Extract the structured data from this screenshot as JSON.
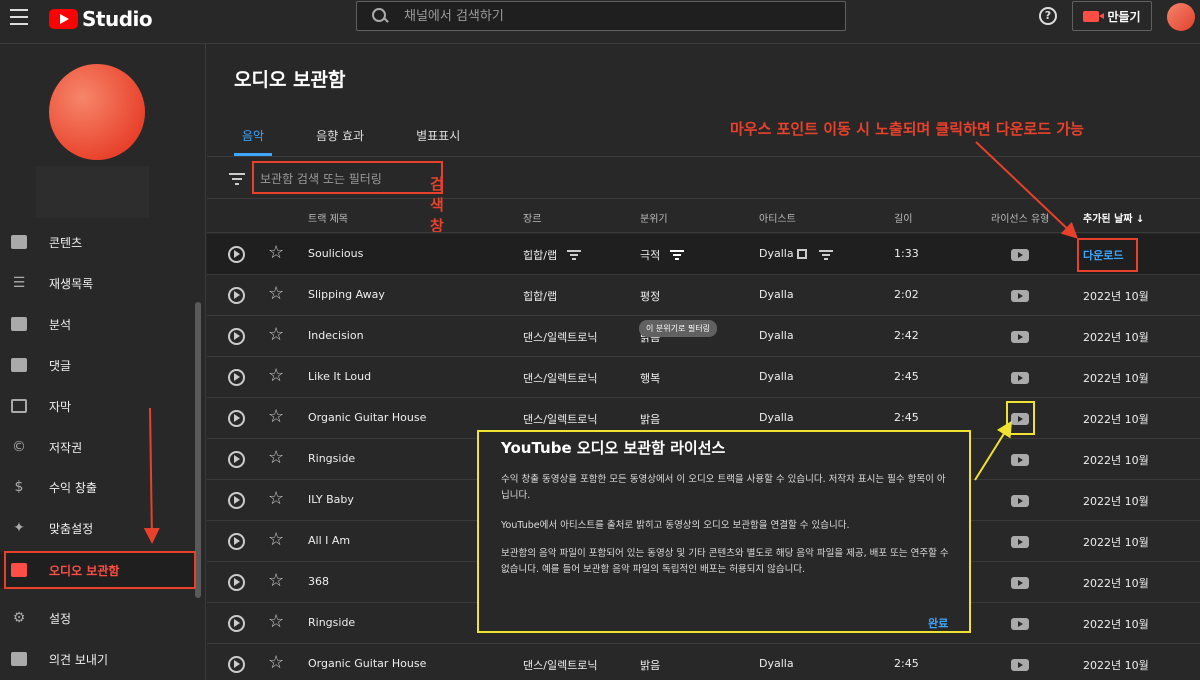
{
  "header": {
    "logo_text": "Studio",
    "search_placeholder": "채널에서 검색하기",
    "create_label": "만들기"
  },
  "sidebar": {
    "items": [
      {
        "label": "콘텐츠",
        "icon": "content-icon"
      },
      {
        "label": "재생목록",
        "icon": "playlist-icon"
      },
      {
        "label": "분석",
        "icon": "analytics-icon"
      },
      {
        "label": "댓글",
        "icon": "comments-icon"
      },
      {
        "label": "자막",
        "icon": "subtitles-icon"
      },
      {
        "label": "저작권",
        "icon": "copyright-icon"
      },
      {
        "label": "수익 창출",
        "icon": "dollar-icon"
      },
      {
        "label": "맞춤설정",
        "icon": "magic-wand-icon"
      },
      {
        "label": "오디오 보관함",
        "icon": "audio-library-icon",
        "active": true
      },
      {
        "label": "설정",
        "icon": "gear-icon"
      },
      {
        "label": "의견 보내기",
        "icon": "feedback-icon"
      }
    ]
  },
  "main": {
    "title": "오디오 보관함",
    "tabs": [
      {
        "label": "음악",
        "active": true
      },
      {
        "label": "음향 효과"
      },
      {
        "label": "별표표시"
      }
    ],
    "filter_placeholder": "보관함 검색 또는 필터링",
    "columns": {
      "title": "트랙 제목",
      "genre": "장르",
      "mood": "분위기",
      "artist": "아티스트",
      "duration": "길이",
      "license": "라이선스 유형",
      "date": "추가된 날짜"
    },
    "rows": [
      {
        "title": "Soulicious",
        "genre": "힙합/랩",
        "mood": "극적",
        "artist": "Dyalla",
        "duration": "1:33",
        "date": "다운로드"
      },
      {
        "title": "Slipping Away",
        "genre": "힙합/랩",
        "mood": "평정",
        "artist": "Dyalla",
        "duration": "2:02",
        "date": "2022년 10월"
      },
      {
        "title": "Indecision",
        "genre": "댄스/일렉트로닉",
        "mood": "밝음",
        "artist": "Dyalla",
        "duration": "2:42",
        "date": "2022년 10월"
      },
      {
        "title": "Like It Loud",
        "genre": "댄스/일렉트로닉",
        "mood": "행복",
        "artist": "Dyalla",
        "duration": "2:45",
        "date": "2022년 10월"
      },
      {
        "title": "Organic Guitar House",
        "genre": "댄스/일렉트로닉",
        "mood": "밝음",
        "artist": "Dyalla",
        "duration": "2:45",
        "date": "2022년 10월"
      },
      {
        "title": "Ringside",
        "genre": "",
        "mood": "",
        "artist": "",
        "duration": "",
        "date": "2022년 10월"
      },
      {
        "title": "ILY Baby",
        "genre": "",
        "mood": "",
        "artist": "",
        "duration": "",
        "date": "2022년 10월"
      },
      {
        "title": "All I Am",
        "genre": "",
        "mood": "",
        "artist": "",
        "duration": "",
        "date": "2022년 10월"
      },
      {
        "title": "368",
        "genre": "",
        "mood": "",
        "artist": "",
        "duration": "",
        "date": "2022년 10월"
      },
      {
        "title": "Ringside",
        "genre": "",
        "mood": "",
        "artist": "",
        "duration": "",
        "date": "2022년 10월"
      },
      {
        "title": "Organic Guitar House",
        "genre": "댄스/일렉트로닉",
        "mood": "밝음",
        "artist": "Dyalla",
        "duration": "2:45",
        "date": "2022년 10월"
      }
    ],
    "tooltip": "이 분위기로 필터링"
  },
  "annotations": {
    "search_label": "검색창",
    "download_hint": "마우스 포인트 이동 시 노출되며 클릭하면 다운로드 가능",
    "color_red": "#e8412b",
    "color_yellow": "#f0e230"
  },
  "license_popup": {
    "title": "YouTube 오디오 보관함 라이선스",
    "p1": "수익 창출 동영상을 포함한 모든 동영상에서 이 오디오 트랙을 사용할 수 있습니다. 저작자 표시는 필수 항목이 아닙니다.",
    "p2": "YouTube에서 아티스트를 출처로 밝히고 동영상의 오디오 보관함을 연결할 수 있습니다.",
    "p3": "보관함의 음악 파일이 포함되어 있는 동영상 및 기타 콘텐츠와 별도로 해당 음악 파일을 제공, 배포 또는 연주할 수 없습니다. 예를 들어 보관함 음악 파일의 독립적인 배포는 허용되지 않습니다.",
    "done_label": "완료"
  }
}
